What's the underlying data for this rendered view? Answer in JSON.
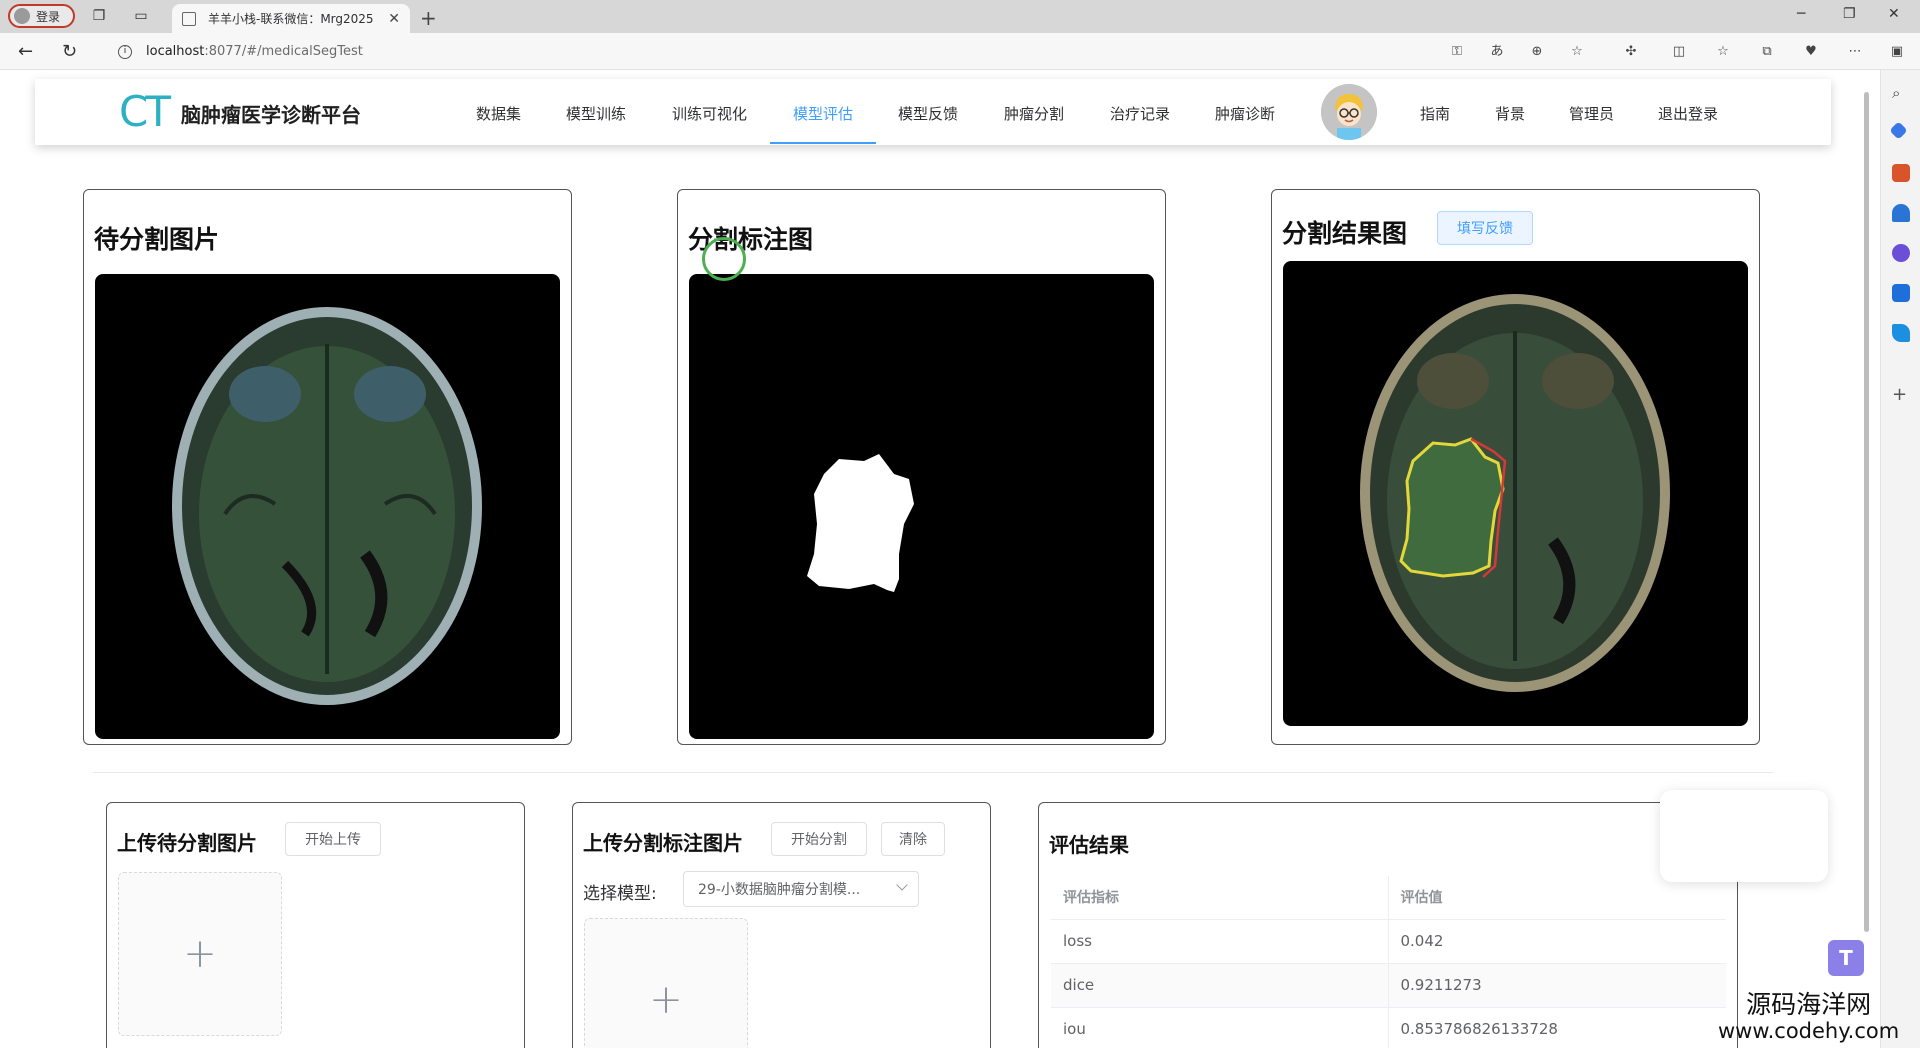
{
  "browser": {
    "profile_label": "登录",
    "tab_title": "羊羊小栈-联系微信：Mrg2025",
    "url_host": "localhost",
    "url_path": ":8077/#/medicalSegTest"
  },
  "app": {
    "logo": "CT",
    "title": "脑肿瘤医学诊断平台",
    "nav": [
      {
        "label": "数据集"
      },
      {
        "label": "模型训练"
      },
      {
        "label": "训练可视化"
      },
      {
        "label": "模型评估",
        "active": true
      },
      {
        "label": "模型反馈"
      },
      {
        "label": "肿瘤分割"
      },
      {
        "label": "治疗记录"
      },
      {
        "label": "肿瘤诊断"
      },
      {
        "label": "指南"
      },
      {
        "label": "背景"
      },
      {
        "label": "管理员"
      },
      {
        "label": "退出登录"
      }
    ],
    "accent_color": "#409eff",
    "logo_color": "#2cb0c4"
  },
  "panels": {
    "original": {
      "title": "待分割图片"
    },
    "mask": {
      "title": "分割标注图"
    },
    "result": {
      "title": "分割结果图",
      "feedback_button": "填写反馈"
    }
  },
  "upload_original": {
    "title": "上传待分割图片",
    "upload_button": "开始上传",
    "plus": "+"
  },
  "upload_mask": {
    "title": "上传分割标注图片",
    "segment_button": "开始分割",
    "clear_button": "清除",
    "model_label": "选择模型:",
    "model_selected": "29-小数据脑肿瘤分割模...",
    "plus": "+"
  },
  "evaluation": {
    "title": "评估结果",
    "headers": [
      "评估指标",
      "评估值"
    ],
    "rows": [
      {
        "metric": "loss",
        "value": "0.042"
      },
      {
        "metric": "dice",
        "value": "0.9211273"
      },
      {
        "metric": "iou",
        "value": "0.853786826133728"
      }
    ]
  },
  "watermark": {
    "line1": "源码海洋网",
    "line2": "www.codehy.com"
  }
}
